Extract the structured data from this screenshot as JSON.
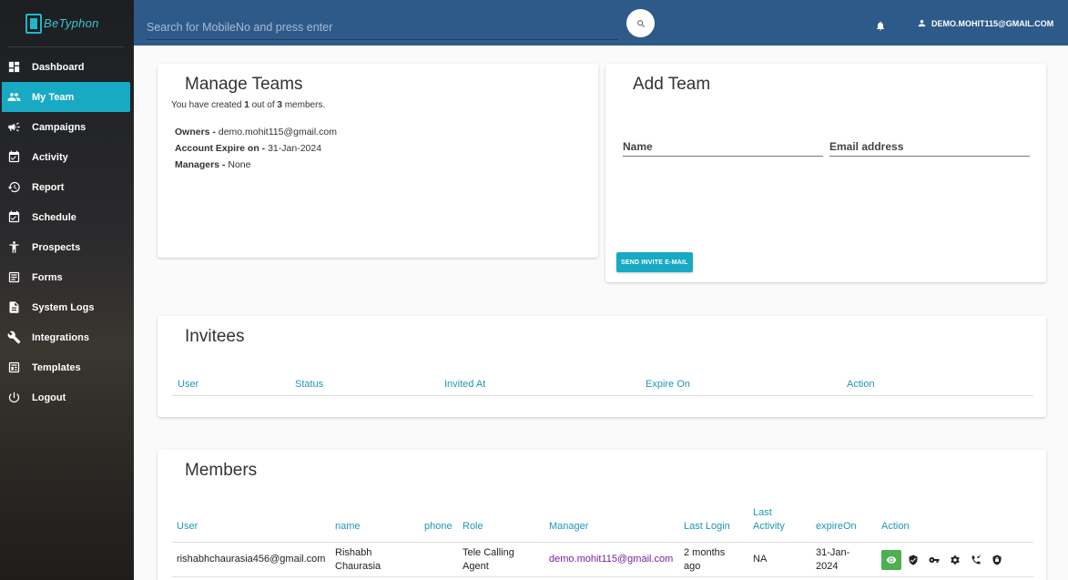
{
  "brand": {
    "logo_text": "BeTyphon",
    "accent": "#18a9c4"
  },
  "sidebar": {
    "items": [
      {
        "label": "Dashboard",
        "icon": "dashboard-icon"
      },
      {
        "label": "My Team",
        "icon": "people-icon",
        "active": true
      },
      {
        "label": "Campaigns",
        "icon": "megaphone-icon"
      },
      {
        "label": "Activity",
        "icon": "calendar-check-icon"
      },
      {
        "label": "Report",
        "icon": "history-icon"
      },
      {
        "label": "Schedule",
        "icon": "calendar-check-icon"
      },
      {
        "label": "Prospects",
        "icon": "person-icon"
      },
      {
        "label": "Forms",
        "icon": "form-icon"
      },
      {
        "label": "System Logs",
        "icon": "document-icon"
      },
      {
        "label": "Integrations",
        "icon": "wrench-icon"
      },
      {
        "label": "Templates",
        "icon": "template-icon"
      },
      {
        "label": "Logout",
        "icon": "power-icon"
      }
    ]
  },
  "topbar": {
    "search_placeholder": "Search for MobileNo and press enter",
    "user_email": "DEMO.MOHIT115@GMAIL.COM"
  },
  "manage_teams": {
    "title": "Manage Teams",
    "sub_prefix": "You have created ",
    "created_count": "1",
    "sub_middle": " out of ",
    "max_count": "3",
    "sub_suffix": " members.",
    "owners_label": "Owners - ",
    "owners_value": "demo.mohit115@gmail.com",
    "expire_label": "Account Expire on - ",
    "expire_value": "31-Jan-2024",
    "managers_label": "Managers - ",
    "managers_value": "None"
  },
  "add_team": {
    "title": "Add Team",
    "name_placeholder": "Name",
    "email_placeholder": "Email address",
    "send_button": "SEND INVITE E-MAIL"
  },
  "invitees": {
    "title": "Invitees",
    "columns": [
      "User",
      "Status",
      "Invited At",
      "Expire On",
      "Action"
    ]
  },
  "members": {
    "title": "Members",
    "columns": [
      "User",
      "name",
      "phone",
      "Role",
      "Manager",
      "Last Login",
      "Last Activity",
      "expireOn",
      "Action"
    ],
    "rows": [
      {
        "user": "rishabhchaurasia456@gmail.com",
        "name": "Rishabh Chaurasia",
        "phone": "",
        "role": "Tele Calling Agent",
        "manager": "demo.mohit115@gmail.com",
        "last_login": "2 months ago",
        "last_activity": "NA",
        "expire_on": "31-Jan-2024",
        "actions": [
          "eye-icon",
          "shield-check-icon",
          "key-icon",
          "gear-icon",
          "phone-missed-icon",
          "shield-lock-icon"
        ]
      }
    ]
  }
}
